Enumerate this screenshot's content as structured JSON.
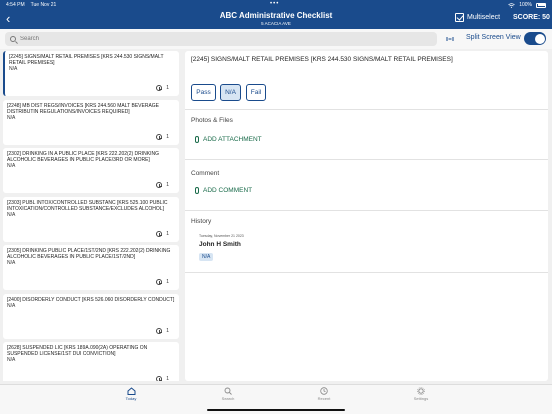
{
  "status": {
    "time": "4:54 PM",
    "date": "Tue Nov 21",
    "battery": "100%"
  },
  "nav": {
    "back_glyph": "‹",
    "title": "ABC Administrative Checklist",
    "subtitle": "5 ACACIA AVE",
    "multiselect_label": "Multiselect",
    "score": "SCORE: 50"
  },
  "search": {
    "placeholder": "Search"
  },
  "split_view": {
    "label": "Split Screen View",
    "enabled": true
  },
  "list": [
    {
      "title": "[2245] SIGNS/MALT RETAIL PREMISES [KRS 244.530 SIGNS/MALT RETAIL PREMISES]",
      "value": "N/A",
      "history_count": "1"
    },
    {
      "title": "[2248] MB DIST REGS/INVOICES [KRS 244.560 MALT BEVERAGE DISTRIBUTIN REGULATIONS/INVOICES REQUIRED]",
      "value": "N/A",
      "history_count": "1"
    },
    {
      "title": "[2302] DRINKING IN A PUBLIC PLACE [KRS 222.202(2) DRINKING ALCOHOLIC BEVERAGES IN PUBLIC PLACE/3RD OR MORE]",
      "value": "N/A",
      "history_count": "1"
    },
    {
      "title": "[2303] PUBL INTOX/CONTROLLED SUBSTANC [KRS 525.100 PUBLIC INTOXICATION/CONTROLLED SUBSTANCE/EXCLUDES ALCOHOL]",
      "value": "N/A",
      "history_count": "1"
    },
    {
      "title": "[2305] DRINKING PUBLIC PLACE/1ST/2ND [KRS 222.202(2) DRINKING ALCOHOLIC BEVERAGES IN PUBLIC PLACE/1ST/2ND]",
      "value": "N/A",
      "history_count": "1"
    },
    {
      "title": "[2400] DISORDERLY CONDUCT [KRS 526.060 DISORDERLY CONDUCT]",
      "value": "N/A",
      "history_count": "1"
    },
    {
      "title": "[2628] SUSPENDED LIC [KRS 189A.090(2A) OPERATING ON SUSPENDED LICENSE/1ST DUI CONVICTION]",
      "value": "N/A",
      "history_count": "1"
    }
  ],
  "detail": {
    "title": "[2245] SIGNS/MALT RETAIL PREMISES [KRS 244.530 SIGNS/MALT RETAIL PREMISES]",
    "buttons": {
      "pass": "Pass",
      "na": "N/A",
      "fail": "Fail"
    },
    "photos_title": "Photos & Files",
    "add_attachment": "ADD ATTACHMENT",
    "comment_title": "Comment",
    "add_comment": "ADD COMMENT",
    "history_title": "History",
    "history_date": "Tuesday, November 21 2023",
    "history_user": "John H Smith",
    "history_value": "N/A"
  },
  "tabs": {
    "today": "Today",
    "search": "Search",
    "recent": "Recent",
    "settings": "Settings"
  },
  "colors": {
    "primary": "#1a4b8c",
    "action_green": "#1a6b4a",
    "selected_fill": "#d7e5f3"
  }
}
